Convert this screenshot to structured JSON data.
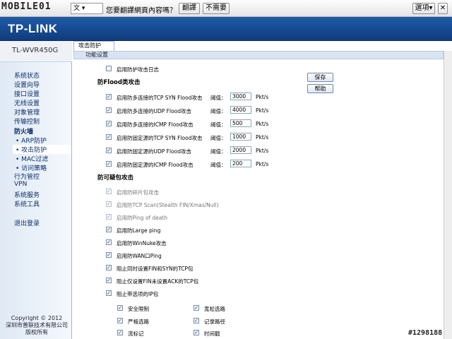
{
  "toolbar": {
    "logo": "MOBILE01",
    "lang": "文",
    "question": "您要翻譯網頁內容嗎？",
    "translate": "翻譯",
    "no": "不需要",
    "options": "選項"
  },
  "header": {
    "brand": "TP-LINK"
  },
  "model": "TL-WVR450G",
  "nav": [
    {
      "label": "系统状态"
    },
    {
      "label": "设置向导"
    },
    {
      "label": "接口设置"
    },
    {
      "label": "无线设置"
    },
    {
      "label": "对象管理"
    },
    {
      "label": "传输控制"
    },
    {
      "label": "防火墙"
    },
    {
      "label": "• ARP防护"
    },
    {
      "label": "• 攻击防护"
    },
    {
      "label": "• MAC过滤"
    },
    {
      "label": "• 访问策略"
    },
    {
      "label": "行为管控"
    },
    {
      "label": "VPN"
    },
    {
      "label": "系统服务"
    },
    {
      "label": "系统工具"
    },
    {
      "label": "退出登录"
    }
  ],
  "copyright": {
    "l1": "Copyright © 2012",
    "l2": "深圳市普联技术有限公司",
    "l3": "版权所有"
  },
  "tab": "攻击防护",
  "section": "功能设置",
  "buttons": {
    "save": "保存",
    "help": "帮助"
  },
  "log_label": "启用防护攻击日志",
  "flood_title": "防Flood类攻击",
  "threshold_label": "阈值：",
  "flood": [
    {
      "label": "启用防多连接的TCP SYN Flood攻击",
      "value": "3000",
      "unit": "Pkt/s"
    },
    {
      "label": "启用防多连接的UDP Flood攻击",
      "value": "4000",
      "unit": "Pkt/s"
    },
    {
      "label": "启用防多连接的ICMP Flood攻击",
      "value": "500",
      "unit": "Pkt/s"
    },
    {
      "label": "启用防固定源的TCP SYN Flood攻击",
      "value": "1000",
      "unit": "Pkt/s"
    },
    {
      "label": "启用防固定源的UDP Flood攻击",
      "value": "2000",
      "unit": "Pkt/s"
    },
    {
      "label": "启用防固定源的ICMP Flood攻击",
      "value": "200",
      "unit": "Pkt/s"
    }
  ],
  "pkt_title": "防可疑包攻击",
  "pkt": [
    {
      "label": "启用防碎片包攻击"
    },
    {
      "label": "启用防TCP Scan(Stealth FIN/Xmas/Null)"
    },
    {
      "label": "启用防Ping of death"
    },
    {
      "label": "启用防Large ping"
    },
    {
      "label": "启用防WinNuke攻击"
    },
    {
      "label": "启用防WAN口Ping"
    },
    {
      "label": "阻止同时设置FIN和SYN的TCP包"
    },
    {
      "label": "阻止仅设置FIN未设置ACK的TCP包"
    },
    {
      "label": "阻止带选项的IP包"
    }
  ],
  "ip_opts": [
    {
      "label": "安全限制"
    },
    {
      "label": "宽松选路"
    },
    {
      "label": "严格选路"
    },
    {
      "label": "记录路径"
    },
    {
      "label": "流标记"
    },
    {
      "label": "时间戳"
    }
  ],
  "watermark": "#1298188"
}
